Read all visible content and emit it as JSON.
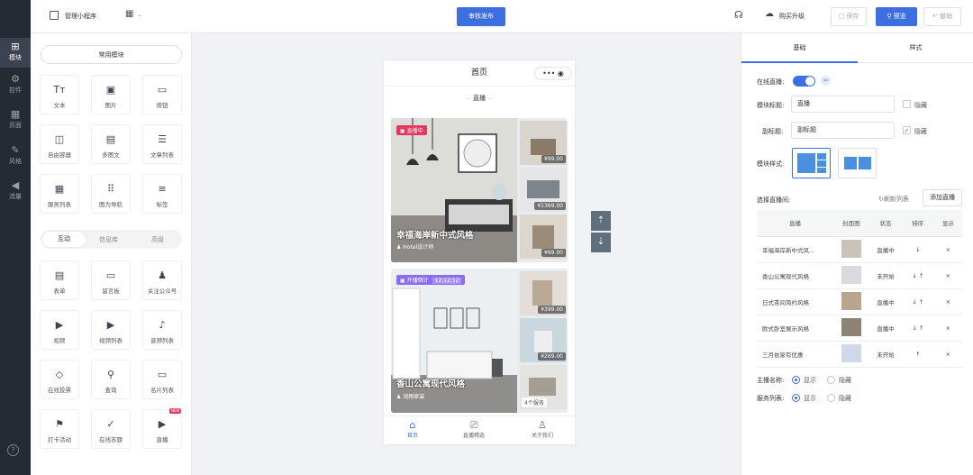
{
  "rail": {
    "items": [
      {
        "label": "模块",
        "icon": "plus-square-icon"
      },
      {
        "label": "控件",
        "icon": "sliders-icon"
      },
      {
        "label": "页面",
        "icon": "grid-icon"
      },
      {
        "label": "风格",
        "icon": "brush-icon"
      },
      {
        "label": "流量",
        "icon": "megaphone-icon"
      }
    ],
    "help_icon": "?"
  },
  "topbar": {
    "app_name": "管理小程序",
    "publish": "审核发布",
    "upgrade": "购买升级",
    "save": "保存",
    "preview": "预览",
    "undo": "撤销"
  },
  "panel": {
    "common_tab": "常用模块",
    "common_tiles": [
      {
        "label": "文本",
        "glyph": "Tт"
      },
      {
        "label": "图片",
        "glyph": "▣"
      },
      {
        "label": "按钮",
        "glyph": "▭"
      },
      {
        "label": "自由容器",
        "glyph": "◫"
      },
      {
        "label": "多图文",
        "glyph": "▤"
      },
      {
        "label": "文章列表",
        "glyph": "☰"
      },
      {
        "label": "服务列表",
        "glyph": "▦"
      },
      {
        "label": "图为导航",
        "glyph": "⠿"
      },
      {
        "label": "标签",
        "glyph": "≡"
      }
    ],
    "tabs": [
      "互动",
      "信息库",
      "高级"
    ],
    "interactive_tiles": [
      {
        "label": "表单",
        "glyph": "▤"
      },
      {
        "label": "留言板",
        "glyph": "▭"
      },
      {
        "label": "关注公众号",
        "glyph": "♟"
      },
      {
        "label": "视频",
        "glyph": "▶"
      },
      {
        "label": "视频列表",
        "glyph": "▶"
      },
      {
        "label": "音频列表",
        "glyph": "♪"
      },
      {
        "label": "在线投票",
        "glyph": "◇"
      },
      {
        "label": "查询",
        "glyph": "⚲"
      },
      {
        "label": "名片列表",
        "glyph": "▭"
      },
      {
        "label": "打卡活动",
        "glyph": "⚑"
      },
      {
        "label": "在线答题",
        "glyph": "✓"
      },
      {
        "label": "直播",
        "glyph": "▶",
        "badge": "NEW"
      }
    ]
  },
  "phone": {
    "title": "首页",
    "section_title": "直播",
    "cards": [
      {
        "status": "直播中",
        "name": "幸福海岸新中式风格",
        "host": "Hotel设计师",
        "prices": [
          "¥99.00",
          "¥1369.00",
          "¥69.00"
        ]
      },
      {
        "status": "开播倒计",
        "countdown": "12:12:12",
        "name": "香山公寓现代风格",
        "host": "润雨家装",
        "prices": [
          "¥399.00",
          "¥269.00"
        ],
        "more": "4个服务"
      }
    ],
    "nav": [
      "首页",
      "直播精选",
      "关于我们"
    ]
  },
  "settings": {
    "tabs": [
      "基础",
      "样式"
    ],
    "live_label": "在线直播:",
    "title_label": "模块标题:",
    "title_value": "直播",
    "hide": "隐藏",
    "subtitle_label": "副标题:",
    "subtitle_value": "副标题",
    "style_label": "模块样式:",
    "room_label": "选择直播间:",
    "refresh": "刷新列表",
    "add": "添加直播",
    "table_headers": [
      "直播",
      "封面图",
      "状态",
      "排序",
      "显示"
    ],
    "rows": [
      {
        "name": "幸福海岸新中式风...",
        "status": "直播中",
        "sort": "↓",
        "del": "×"
      },
      {
        "name": "香山公寓现代风格",
        "status": "未开始",
        "sort": "↓ ↑",
        "del": "×"
      },
      {
        "name": "日式茶间简约风格",
        "status": "直播中",
        "sort": "↓ ↑",
        "del": "×"
      },
      {
        "name": "欧式卧室展示风格",
        "status": "直播中",
        "sort": "↓ ↑",
        "del": "×"
      },
      {
        "name": "三月依家有优惠",
        "status": "未开始",
        "sort": "↑",
        "del": "×"
      }
    ],
    "anchor_label": "主播名称:",
    "services_label": "服务列表:",
    "show": "显示",
    "hidden": "隐藏"
  },
  "colors": {
    "accent": "#3d6fe0",
    "rail_bg": "#262a33",
    "live_badge": "#e8365d",
    "countdown_badge": "#8a6cf0"
  }
}
